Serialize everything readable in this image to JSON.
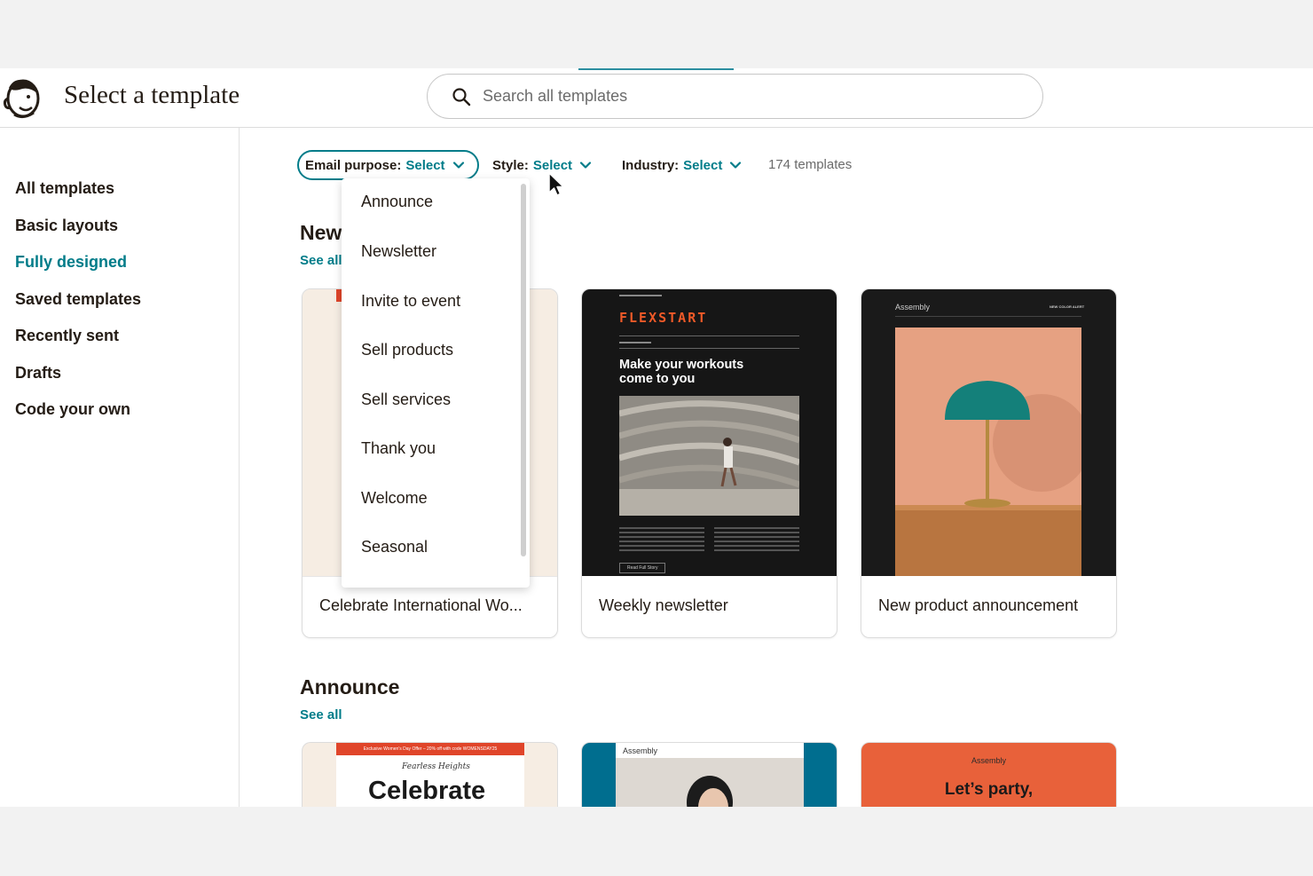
{
  "header": {
    "title": "Select a template",
    "search_placeholder": "Search all templates"
  },
  "sidebar": {
    "items": [
      {
        "label": "All templates"
      },
      {
        "label": "Basic layouts"
      },
      {
        "label": "Fully designed"
      },
      {
        "label": "Saved templates"
      },
      {
        "label": "Recently sent"
      },
      {
        "label": "Drafts"
      },
      {
        "label": "Code your own"
      }
    ]
  },
  "filters": {
    "purpose": {
      "label": "Email purpose:",
      "value": "Select"
    },
    "style": {
      "label": "Style:",
      "value": "Select"
    },
    "industry": {
      "label": "Industry:",
      "value": "Select"
    },
    "count": "174 templates"
  },
  "purpose_dropdown": {
    "options": [
      "Announce",
      "Newsletter",
      "Invite to event",
      "Sell products",
      "Sell services",
      "Thank you",
      "Welcome",
      "Seasonal"
    ]
  },
  "sections": [
    {
      "title": "New",
      "see_all": "See all",
      "cards": [
        {
          "label": "Celebrate International Wo..."
        },
        {
          "label": "Weekly newsletter",
          "thumb": {
            "brand": "FLEXSTART",
            "headline_1": "Make your workouts",
            "headline_2": "come to you",
            "cta": "Read Full Story"
          }
        },
        {
          "label": "New product announcement",
          "thumb": {
            "brand": "Assembly",
            "tag": "NEW COLOR ALERT"
          }
        }
      ]
    },
    {
      "title": "Announce",
      "see_all": "See all",
      "cards": [
        {
          "thumb": {
            "banner": "Exclusive Women's Day Offer – 20% off with code WOMENSDAY25",
            "script": "Fearless Heights",
            "headline": "Celebrate"
          }
        },
        {
          "thumb": {
            "brand": "Assembly"
          }
        },
        {
          "thumb": {
            "brand": "Assembly",
            "headline": "Let’s party,"
          }
        }
      ]
    }
  ],
  "colors": {
    "accent": "#007c89",
    "flexstart_orange": "#f05a28",
    "party_orange": "#e8613a",
    "teal_blue": "#006e8f"
  }
}
